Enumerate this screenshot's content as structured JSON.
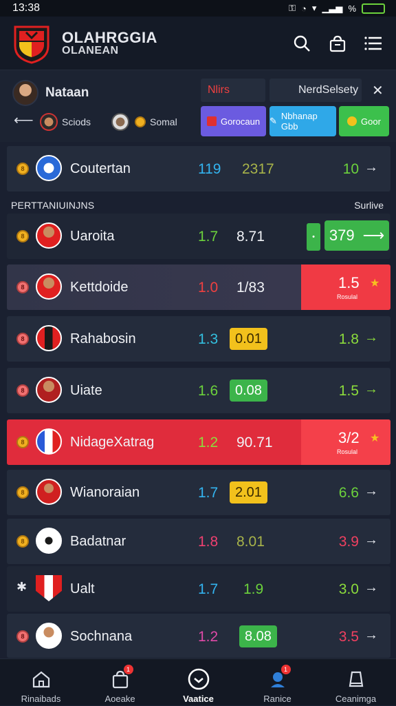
{
  "status_bar": {
    "time": "13:38",
    "signal": "%"
  },
  "header": {
    "brand_line1": "OLAHRGGIA",
    "brand_line2": "OLANEAN"
  },
  "user": {
    "name": "Nataan",
    "chips": [
      {
        "label": "Sciods"
      },
      {
        "label": "Somal"
      }
    ]
  },
  "tabs": [
    {
      "label": "Nlirs",
      "color": "#f04040"
    },
    {
      "label": "NerdSelsety"
    }
  ],
  "action_buttons": [
    {
      "label": "Gorocaun",
      "color": "#6b5be0"
    },
    {
      "label": "Nbhanap Gbb",
      "color": "#2fa8e8"
    },
    {
      "label": "Goor",
      "color": "#3cc04c"
    }
  ],
  "featured_row": {
    "name": "Coutertan",
    "v1": "119",
    "v2": "2317",
    "v3": "10",
    "v1_color": "#33b4f0",
    "v2_color": "#a8b44a",
    "v3_color": "#6cd23c"
  },
  "section": {
    "title": "PERTTANIUINJNS",
    "right": "Surlive"
  },
  "rows": [
    {
      "name": "Uaroita",
      "v1": "1.7",
      "v1_color": "#6cd23c",
      "v2": "8.71",
      "v3": "379",
      "coin": "8",
      "coin_style": "gold",
      "style": "dark",
      "v3_box": "green-button"
    },
    {
      "name": "Kettdoide",
      "v1": "1.0",
      "v1_color": "#f04040",
      "v2": "1/83",
      "v3": "1.5",
      "coin": "8",
      "coin_style": "pink",
      "style": "sel",
      "v3_box": "red",
      "v3_sub": "Rosulal"
    },
    {
      "name": "Rahabosin",
      "v1": "1.3",
      "v1_color": "#33c0e0",
      "v2": "0.01",
      "v2_box": "#f2c11c",
      "v3": "1.8",
      "v3_color": "#8cdc3c",
      "coin": "8",
      "coin_style": "pink",
      "style": "normal"
    },
    {
      "name": "Uiate",
      "v1": "1.6",
      "v1_color": "#6cd23c",
      "v2": "0.08",
      "v2_box": "#3cb44a",
      "v3": "1.5",
      "v3_color": "#8cdc3c",
      "coin": "8",
      "coin_style": "pink",
      "style": "normal"
    },
    {
      "name": "NidageXatrag",
      "v1": "1.2",
      "v1_color": "#8cdc3c",
      "v2": "90.71",
      "v3": "3/2",
      "coin": "8",
      "coin_style": "gold",
      "style": "red",
      "v3_box": "red",
      "v3_sub": "Rosulal"
    },
    {
      "name": "Wianoraian",
      "v1": "1.7",
      "v1_color": "#33b4f0",
      "v2": "2.01",
      "v2_box": "#f2c11c",
      "v3": "6.6",
      "v3_color": "#6cd23c",
      "coin": "8",
      "coin_style": "gold",
      "style": "normal"
    },
    {
      "name": "Badatnar",
      "v1": "1.8",
      "v1_color": "#f04070",
      "v2": "8.01",
      "v2_color": "#a8b44a",
      "v3": "3.9",
      "v3_color": "#f04060",
      "coin": "8",
      "coin_style": "gold",
      "style": "normal"
    },
    {
      "name": "Ualt",
      "v1": "1.7",
      "v1_color": "#33b4f0",
      "v2": "1.9",
      "v2_color": "#6cd23c",
      "v3": "3.0",
      "v3_color": "#8cdc3c",
      "coin": "✱",
      "coin_style": "none",
      "style": "dark"
    },
    {
      "name": "Sochnana",
      "v1": "1.2",
      "v1_color": "#e04aa8",
      "v2": "8.08",
      "v2_box": "#3cb44a",
      "v3": "3.5",
      "v3_color": "#f04060",
      "coin": "8",
      "coin_style": "pink",
      "style": "normal"
    }
  ],
  "bottom_nav": [
    {
      "label": "Rinaibads",
      "icon": "home-icon"
    },
    {
      "label": "Aoeake",
      "icon": "bag-icon",
      "badge": "1"
    },
    {
      "label": "Vaatice",
      "icon": "check-circle-icon"
    },
    {
      "label": "Ranice",
      "icon": "user-icon",
      "badge": "1"
    },
    {
      "label": "Ceanimga",
      "icon": "settings-icon"
    }
  ]
}
